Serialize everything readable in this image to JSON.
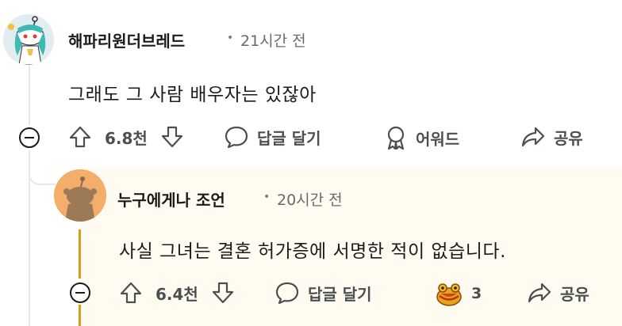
{
  "comment1": {
    "author": "해파리원더브레드",
    "separator": "•",
    "time": "21시간 전",
    "body": "그래도 그 사람 배우자는 있잖아",
    "upvote_count": "6.8천",
    "reply_label": "답글 달기",
    "award_label": "어워드",
    "share_label": "공유"
  },
  "comment2": {
    "author": "누구에게나 조언",
    "separator": "•",
    "time": "20시간 전",
    "body": "사실 그녀는 결혼 허가증에 서명한 적이 없습니다.",
    "upvote_count": "6.4천",
    "reply_label": "답글 달기",
    "award_count": "3",
    "share_label": "공유"
  },
  "colors": {
    "thread_line": "#e5e7e9",
    "highlight_bg": "#fffbf0",
    "highlight_line": "#d4a017",
    "icon_gray": "#4a4f52"
  },
  "icons": {
    "upvote": "upvote-arrow-icon",
    "downvote": "downvote-arrow-icon",
    "reply": "speech-bubble-icon",
    "award": "award-ribbon-icon",
    "share": "share-arrow-icon",
    "collapse": "minus-circle-icon",
    "award_given": "gold-toad-award-icon"
  }
}
